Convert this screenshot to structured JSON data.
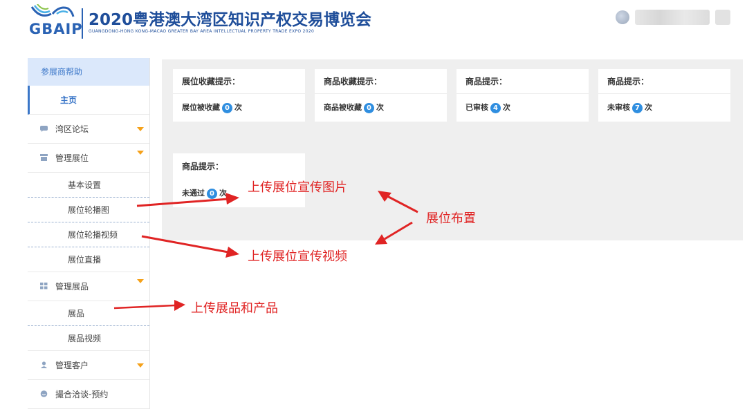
{
  "header": {
    "logo_text": "GBAIP",
    "title": "2020粤港澳大湾区知识产权交易博览会",
    "subtitle": "GUANGDONG-HONG KONG-MACAO GREATER BAY AREA INTELLECTUAL PROPERTY TRADE EXPO 2020"
  },
  "sidebar": {
    "help": "参展商帮助",
    "home": "主页",
    "groups": [
      {
        "label": "湾区论坛"
      },
      {
        "label": "管理展位",
        "items": [
          "基本设置",
          "展位轮播图",
          "展位轮播视频",
          "展位直播"
        ]
      },
      {
        "label": "管理展品",
        "items": [
          "展品",
          "展品视频"
        ]
      },
      {
        "label": "管理客户"
      },
      {
        "label": "撮合洽谈-预约"
      }
    ]
  },
  "cards": [
    {
      "title": "展位收藏提示：",
      "prefix": "展位被收藏",
      "count": "0",
      "suffix": "次"
    },
    {
      "title": "商品收藏提示：",
      "prefix": "商品被收藏",
      "count": "0",
      "suffix": "次"
    },
    {
      "title": "商品提示：",
      "prefix": "已审核",
      "count": "4",
      "suffix": "次"
    },
    {
      "title": "商品提示：",
      "prefix": "未审核",
      "count": "7",
      "suffix": "次"
    },
    {
      "title": "商品提示：",
      "prefix": "未通过",
      "count": "0",
      "suffix": "次"
    }
  ],
  "annotations": {
    "booth_images": "上传展位宣传图片",
    "booth_layout": "展位布置",
    "booth_video": "上传展位宣传视频",
    "products": "上传展品和产品"
  },
  "colors": {
    "accent": "#3a76c8",
    "annotation": "#e02424",
    "badge": "#2f8ee0",
    "caret": "#f5a11a"
  }
}
